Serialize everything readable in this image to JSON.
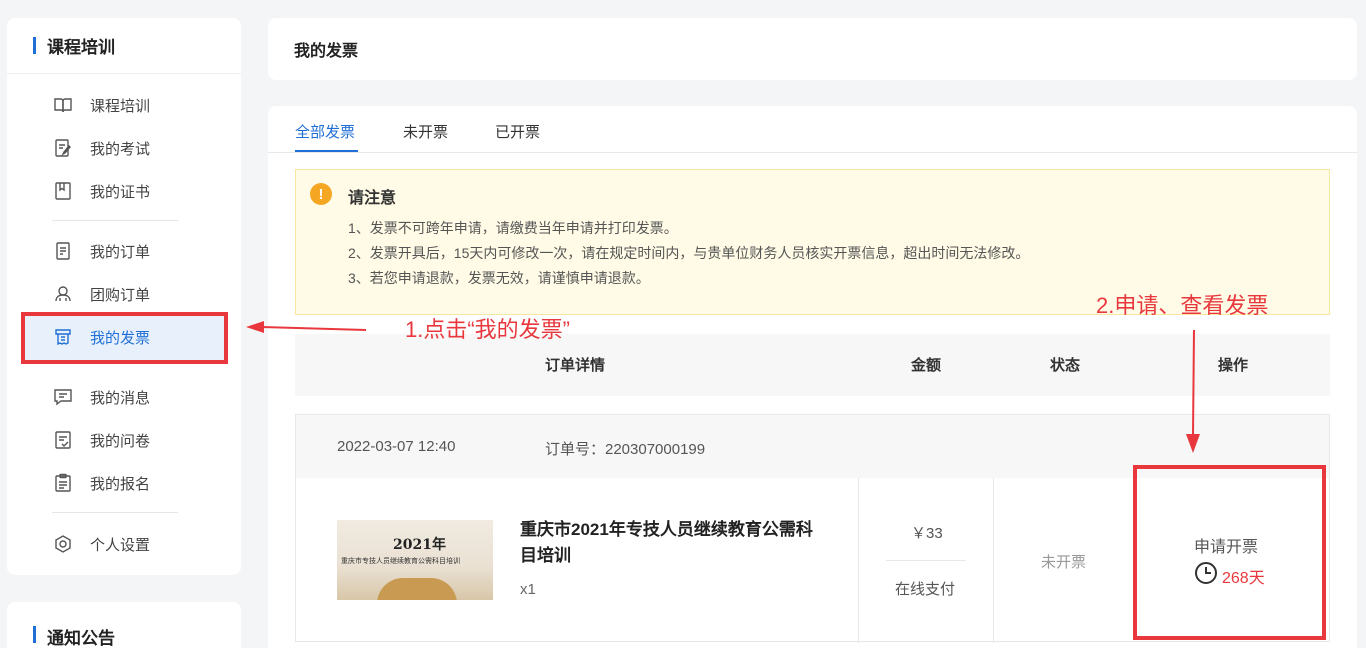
{
  "sidebar": {
    "title": "课程培训",
    "items": [
      {
        "label": "课程培训",
        "icon": "book-icon"
      },
      {
        "label": "我的考试",
        "icon": "exam-icon"
      },
      {
        "label": "我的证书",
        "icon": "certificate-icon"
      },
      {
        "label": "我的订单",
        "icon": "order-icon"
      },
      {
        "label": "团购订单",
        "icon": "group-icon"
      },
      {
        "label": "我的发票",
        "icon": "invoice-icon",
        "active": true
      },
      {
        "label": "我的消息",
        "icon": "message-icon"
      },
      {
        "label": "我的问卷",
        "icon": "survey-icon"
      },
      {
        "label": "我的报名",
        "icon": "clipboard-icon"
      },
      {
        "label": "个人设置",
        "icon": "settings-icon"
      }
    ],
    "notice_title": "通知公告"
  },
  "page_title": "我的发票",
  "tabs": [
    "全部发票",
    "未开票",
    "已开票"
  ],
  "notice": {
    "title": "请注意",
    "lines": [
      "1、发票不可跨年申请，请缴费当年申请并打印发票。",
      "2、发票开具后，15天内可修改一次，请在规定时间内，与贵单位财务人员核实开票信息，超出时间无法修改。",
      "3、若您申请退款，发票无效，请谨慎申请退款。"
    ]
  },
  "annotations": {
    "step1": "1.点击“我的发票”",
    "step2": "2.申请、查看发票"
  },
  "table": {
    "headers": [
      "订单详情",
      "金额",
      "状态",
      "操作"
    ]
  },
  "order": {
    "date": "2022-03-07 12:40",
    "order_no": "订单号：220307000199",
    "thumb_year": "2021年",
    "thumb_sub": "重庆市专技人员继续教育公需科目培训",
    "title": "重庆市2021年专技人员继续教育公需科目培训",
    "qty": "x1",
    "price": "￥33",
    "payment": "在线支付",
    "status": "未开票",
    "action": "申请开票",
    "days_left": "268天"
  },
  "colors": {
    "accent": "#1f6fd6",
    "annotation_red": "#e8383d",
    "alert_bg": "#fffbe6"
  }
}
